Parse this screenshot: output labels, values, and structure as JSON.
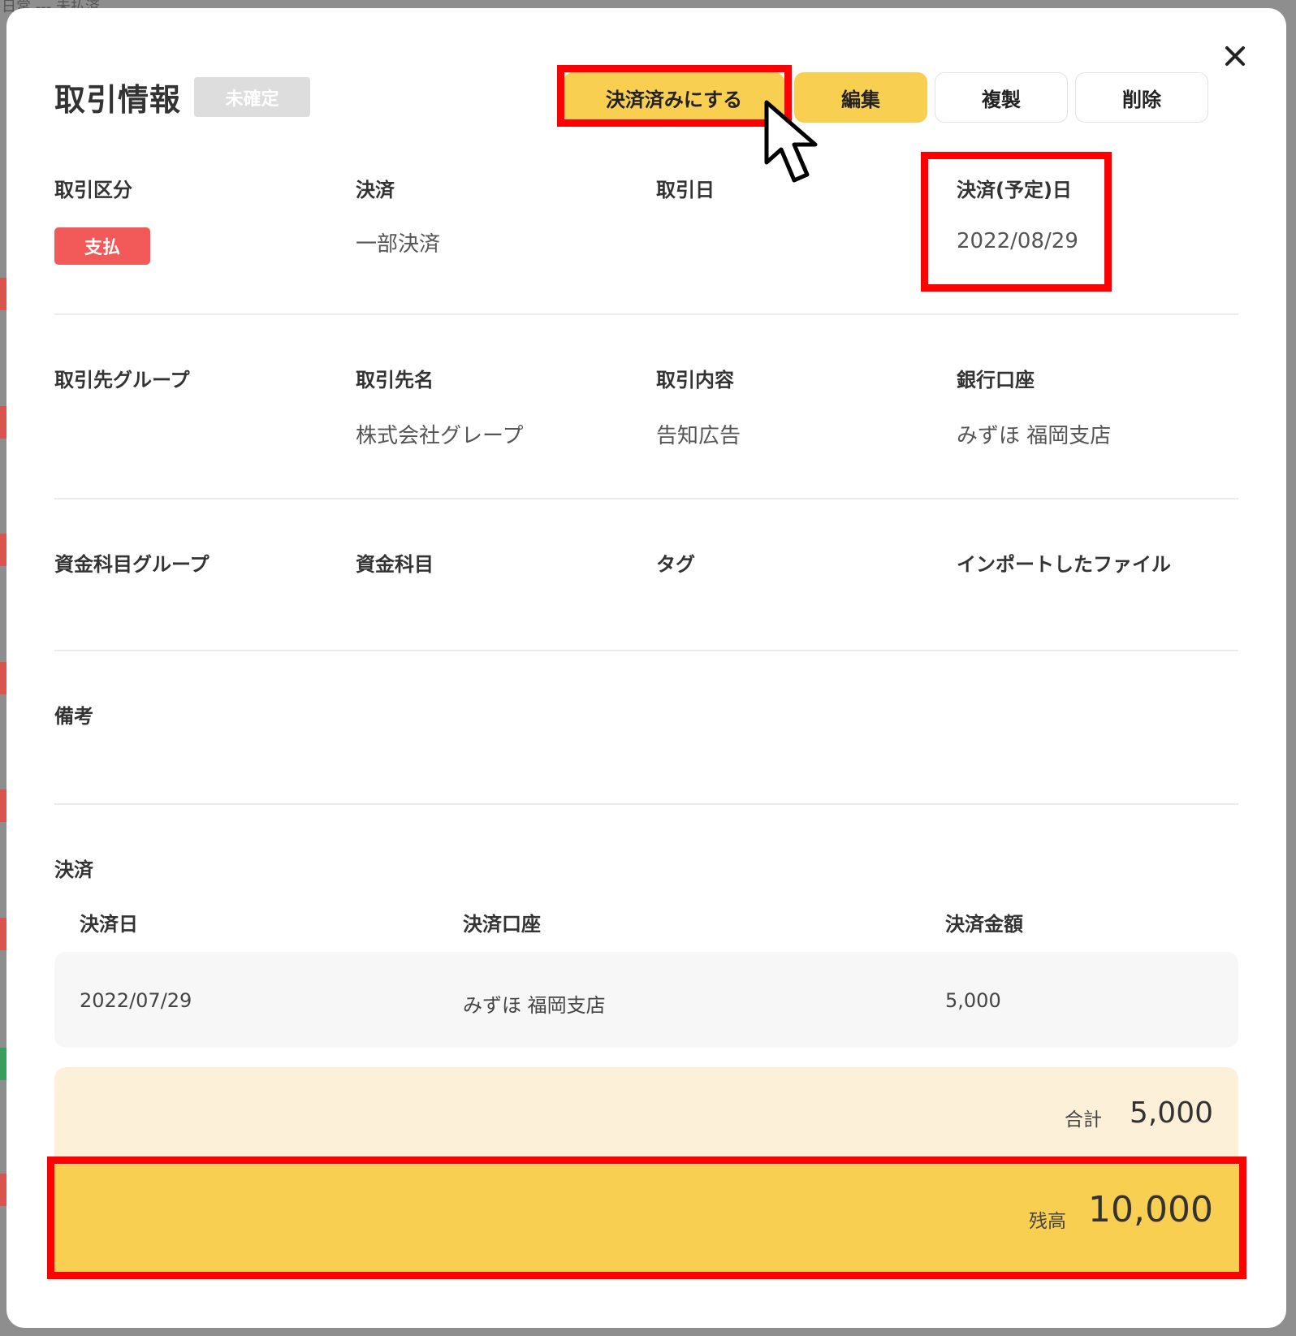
{
  "background": {
    "top_text": "日常  ---  未払済"
  },
  "modal": {
    "title": "取引情報",
    "status_badge": "未確定",
    "close_icon": "close-icon",
    "actions": {
      "settle": "決済済みにする",
      "edit": "編集",
      "duplicate": "複製",
      "delete": "削除"
    },
    "section1": {
      "type_label": "取引区分",
      "type_value": "支払",
      "settlement_label": "決済",
      "settlement_value": "一部決済",
      "date_label": "取引日",
      "date_value": "",
      "due_label": "決済(予定)日",
      "due_value": "2022/08/29"
    },
    "section2": {
      "partner_group_label": "取引先グループ",
      "partner_group_value": "",
      "partner_name_label": "取引先名",
      "partner_name_value": "株式会社グレープ",
      "content_label": "取引内容",
      "content_value": "告知広告",
      "bank_label": "銀行口座",
      "bank_value": "みずほ 福岡支店"
    },
    "section3": {
      "fund_group_label": "資金科目グループ",
      "fund_label": "資金科目",
      "tag_label": "タグ",
      "import_label": "インポートしたファイル"
    },
    "notes_label": "備考",
    "settlements": {
      "title": "決済",
      "headers": [
        "決済日",
        "決済口座",
        "決済金額"
      ],
      "rows": [
        [
          "2022/07/29",
          "みずほ 福岡支店",
          "5,000"
        ]
      ]
    },
    "summary": {
      "total_label": "合計",
      "total_value": "5,000",
      "balance_label": "残高",
      "balance_value": "10,000"
    }
  },
  "colors": {
    "accent_yellow": "#f9cf52",
    "payment_red": "#f25a5a",
    "highlight_red": "#ff0000",
    "total_bg": "#fcf1d8"
  }
}
